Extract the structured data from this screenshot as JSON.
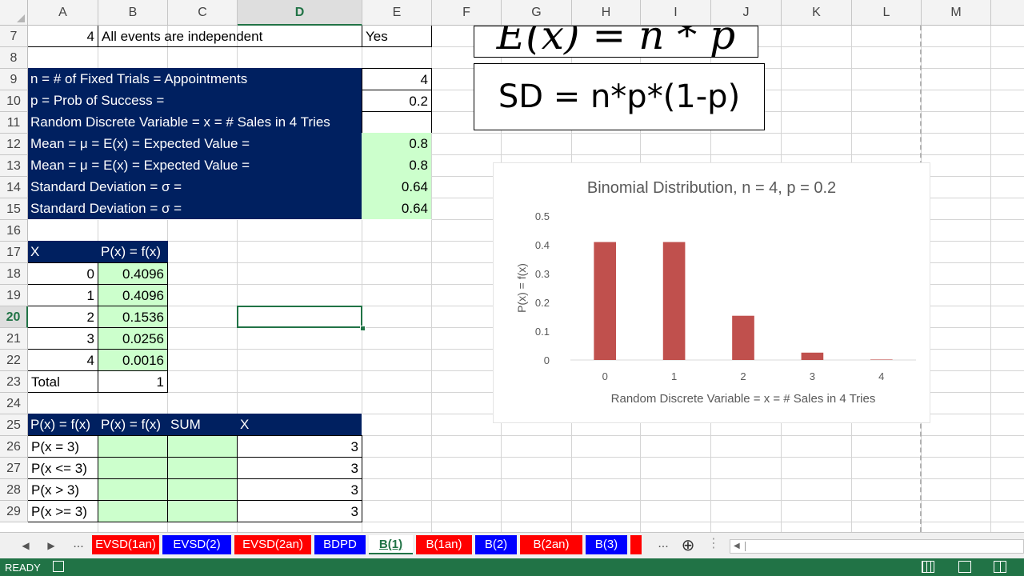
{
  "columns": [
    {
      "label": "A"
    },
    {
      "label": "B"
    },
    {
      "label": "C"
    },
    {
      "label": "D"
    },
    {
      "label": "E"
    },
    {
      "label": "F"
    },
    {
      "label": "G"
    },
    {
      "label": "H"
    },
    {
      "label": "I"
    },
    {
      "label": "J"
    },
    {
      "label": "K"
    },
    {
      "label": "L"
    },
    {
      "label": "M"
    }
  ],
  "rows": [
    "7",
    "8",
    "9",
    "10",
    "11",
    "12",
    "13",
    "14",
    "15",
    "16",
    "17",
    "18",
    "19",
    "20",
    "21",
    "22",
    "23",
    "24",
    "25",
    "26",
    "27",
    "28",
    "29"
  ],
  "selected_row": "20",
  "selected_column": "D",
  "cells": {
    "A7": "4",
    "B7": "All events are independent",
    "E7": "Yes",
    "A9": "n = # of Fixed Trials = Appointments",
    "E9": "4",
    "A10": "p = Prob of Success =",
    "E10": "0.2",
    "A11": "Random Discrete Variable = x = # Sales in 4 Tries",
    "A12": "Mean = μ = E(x) = Expected Value =",
    "E12": "0.8",
    "A13": "Mean = μ = E(x) = Expected Value =",
    "E13": "0.8",
    "A14": "Standard Deviation = σ =",
    "E14": "0.64",
    "A15": "Standard Deviation = σ =",
    "E15": "0.64",
    "A17": "X",
    "B17": "P(x) = f(x)",
    "A18": "0",
    "B18": "0.4096",
    "A19": "1",
    "B19": "0.4096",
    "A20": "2",
    "B20": "0.1536",
    "A21": "3",
    "B21": "0.0256",
    "A22": "4",
    "B22": "0.0016",
    "A23": "Total",
    "B23": "1",
    "A25": "P(x) = f(x)",
    "B25": "P(x) = f(x)",
    "C25": "SUM",
    "D25": "X",
    "A26": "P(x = 3)",
    "D26": "3",
    "A27": "P(x <= 3)",
    "D27": "3",
    "A28": "P(x > 3)",
    "D28": "3",
    "A29": "P(x >= 3)",
    "D29": "3"
  },
  "formulas": {
    "expected_value": "E(x) = n * p",
    "std_dev": "SD = n*p*(1-p)"
  },
  "chart_data": {
    "type": "bar",
    "title": "Binomial Distribution, n = 4, p = 0.2",
    "xlabel": "Random Discrete Variable = x = # Sales in 4 Tries",
    "ylabel": "P(x) = f(x)",
    "categories": [
      "0",
      "1",
      "2",
      "3",
      "4"
    ],
    "values": [
      0.4096,
      0.4096,
      0.1536,
      0.0256,
      0.0016
    ],
    "ylim": [
      0,
      0.5
    ],
    "yticks": [
      "0",
      "0.1",
      "0.2",
      "0.3",
      "0.4",
      "0.5"
    ],
    "grid": false,
    "legend": "none",
    "bar_color": "#c0504d"
  },
  "tabs": [
    {
      "label": "EVSD(1an)",
      "color": "#ff0000"
    },
    {
      "label": "EVSD(2)",
      "color": "#0000ff"
    },
    {
      "label": "EVSD(2an)",
      "color": "#ff0000"
    },
    {
      "label": "BDPD",
      "color": "#0000ff"
    },
    {
      "label": "B(1)",
      "color": "#ffffff"
    },
    {
      "label": "B(1an)",
      "color": "#ff0000"
    },
    {
      "label": "B(2)",
      "color": "#0000ff"
    },
    {
      "label": "B(2an)",
      "color": "#ff0000"
    },
    {
      "label": "B(3)",
      "color": "#0000ff"
    },
    {
      "label": "",
      "color": "#ff0000"
    }
  ],
  "active_tab": "B(1)",
  "tabbar": {
    "more_left": "...",
    "more_right": "...",
    "add": "⊕",
    "prev": "◀",
    "next": "▶"
  },
  "status": {
    "ready": "READY"
  },
  "colors": {
    "navy": "#002060",
    "green_fill": "#ccffcc",
    "excel_green": "#217346",
    "bar": "#c0504d"
  }
}
